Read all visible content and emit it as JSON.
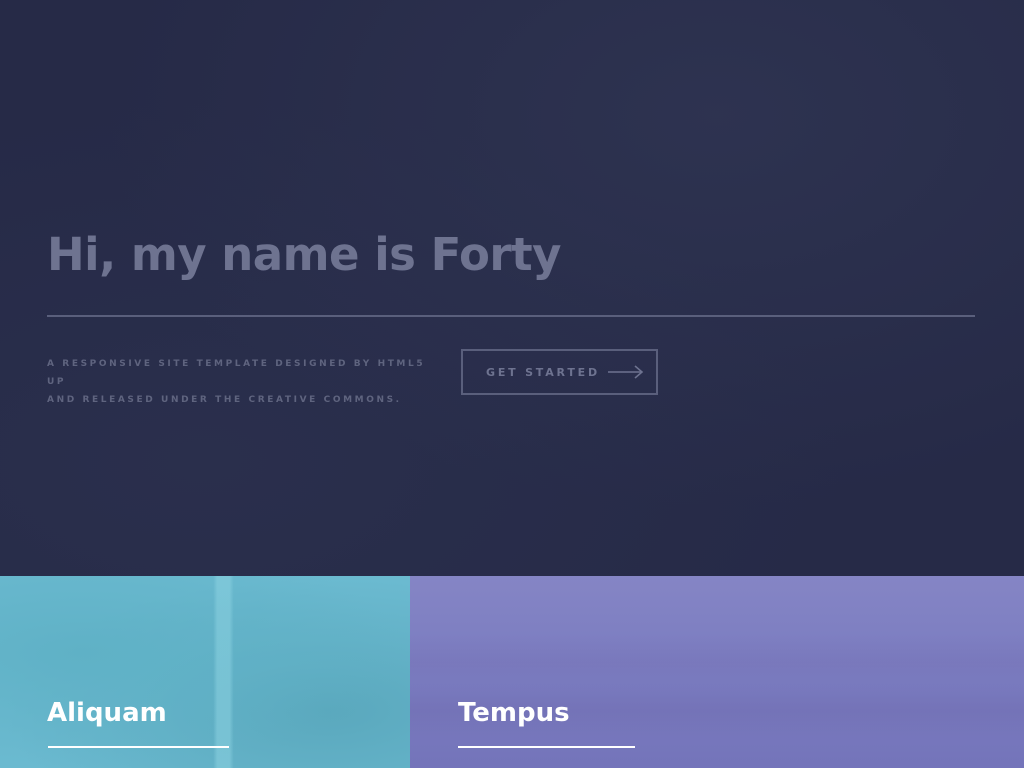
{
  "banner": {
    "title": "Hi, my name is Forty",
    "tagline_line1": "A RESPONSIVE SITE TEMPLATE DESIGNED BY HTML5 UP",
    "tagline_line2": "AND RELEASED UNDER THE CREATIVE COMMONS.",
    "cta_label": "GET STARTED",
    "cta_icon": "arrow-right-icon"
  },
  "tiles": [
    {
      "title": "Aliquam",
      "color": "#6bbad0"
    },
    {
      "title": "Tempus",
      "color": "#7b7dc1"
    }
  ],
  "colors": {
    "background": "#242943",
    "banner_text": "#6e7390",
    "tile_text": "#ffffff"
  }
}
